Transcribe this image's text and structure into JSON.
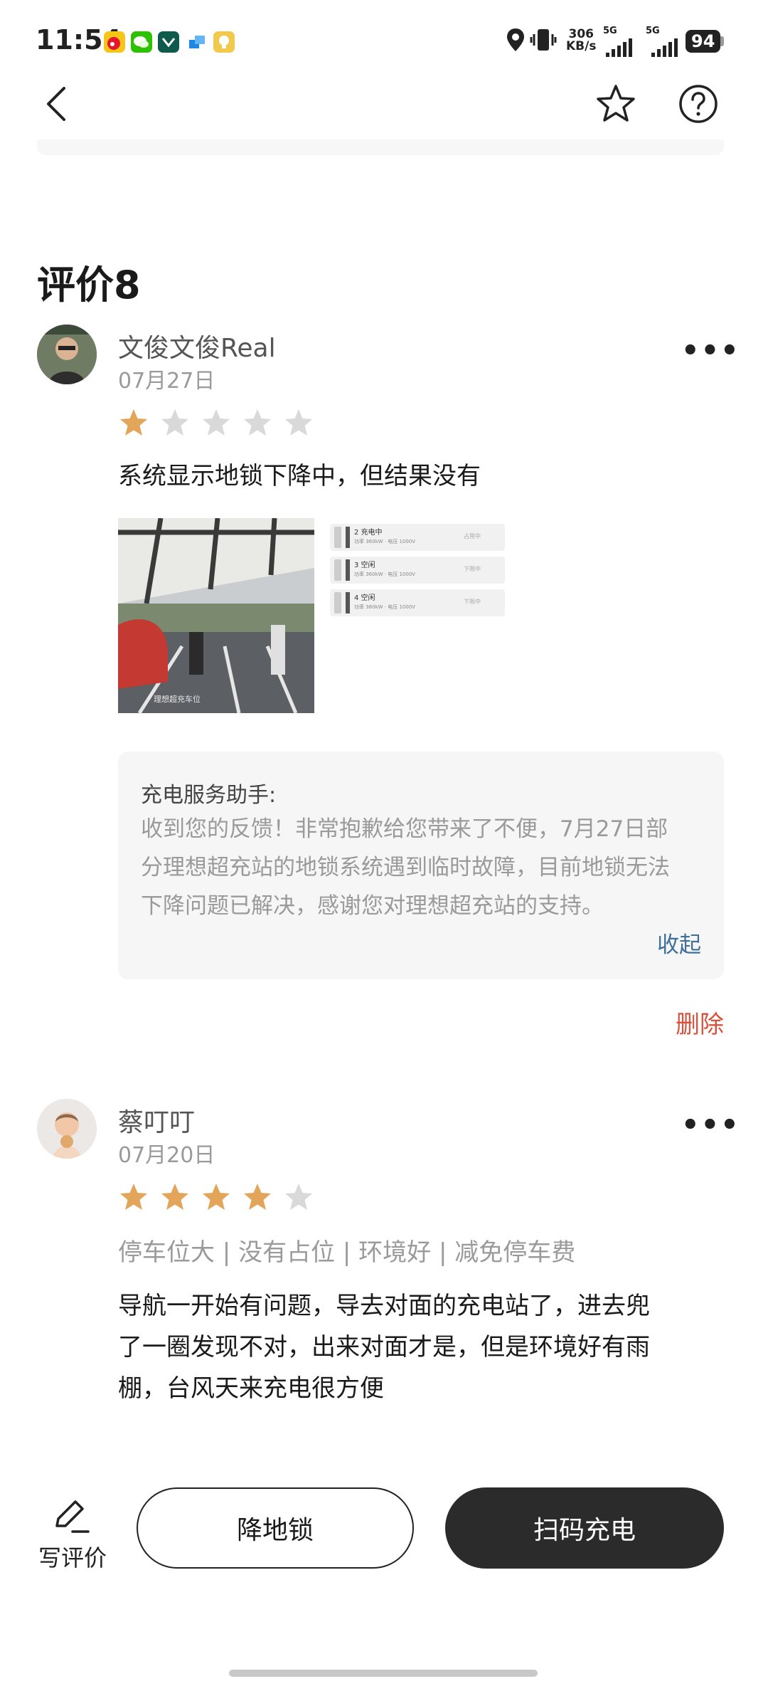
{
  "status_bar": {
    "time": "11:54",
    "net_speed_value": "306",
    "net_speed_unit": "KB/s",
    "sim1": "5G",
    "sim2": "5G",
    "battery": "94"
  },
  "header": {
    "back_icon": "chevron-left-icon",
    "favorite_icon": "star-outline-icon",
    "help_icon": "question-circle-icon"
  },
  "reviews_section": {
    "title": "评价8"
  },
  "reviews": [
    {
      "username": "文俊文俊Real",
      "date": "07月27日",
      "rating": 1,
      "rating_max": 5,
      "text": "系统显示地锁下降中，但结果没有",
      "screenshot_rows": [
        {
          "title": "2 充电中",
          "detail": "功率 360kW · 电压 1000V",
          "status": "占用中"
        },
        {
          "title": "3 空闲",
          "detail": "功率 360kW · 电压 1000V",
          "status": "下限中"
        },
        {
          "title": "4 空闲",
          "detail": "功率 360kW · 电压 1000V",
          "status": "下限中"
        }
      ],
      "photo_text": "理想超充车位",
      "reply_title": "充电服务助手:",
      "reply_lines": [
        "收到您的反馈！非常抱歉给您带来了不便，7月27日部",
        "分理想超充站的地锁系统遇到临时故障，目前地锁无法",
        "下降问题已解决，感谢您对理想超充站的支持。"
      ],
      "collapse_label": "收起",
      "delete_label": "删除"
    },
    {
      "username": "蔡叮叮",
      "date": "07月20日",
      "rating": 4,
      "rating_max": 5,
      "tags": "停车位大 | 没有占位 | 环境好 | 减免停车费",
      "text_lines": [
        "导航一开始有问题，导去对面的充电站了，进去兜",
        "了一圈发现不对，出来对面才是，但是环境好有雨",
        "棚，台风天来充电很方便"
      ]
    }
  ],
  "bottom_bar": {
    "write_review_label": "写评价",
    "write_review_icon": "pencil-icon",
    "lower_lock_label": "降地锁",
    "scan_charge_label": "扫码充电"
  },
  "colors": {
    "star_filled": "#e2a55a",
    "star_empty": "#d9d9d9",
    "link_blue": "#3f6f9a",
    "delete_red": "#d9503b",
    "primary_dark": "#2b2b2b"
  }
}
